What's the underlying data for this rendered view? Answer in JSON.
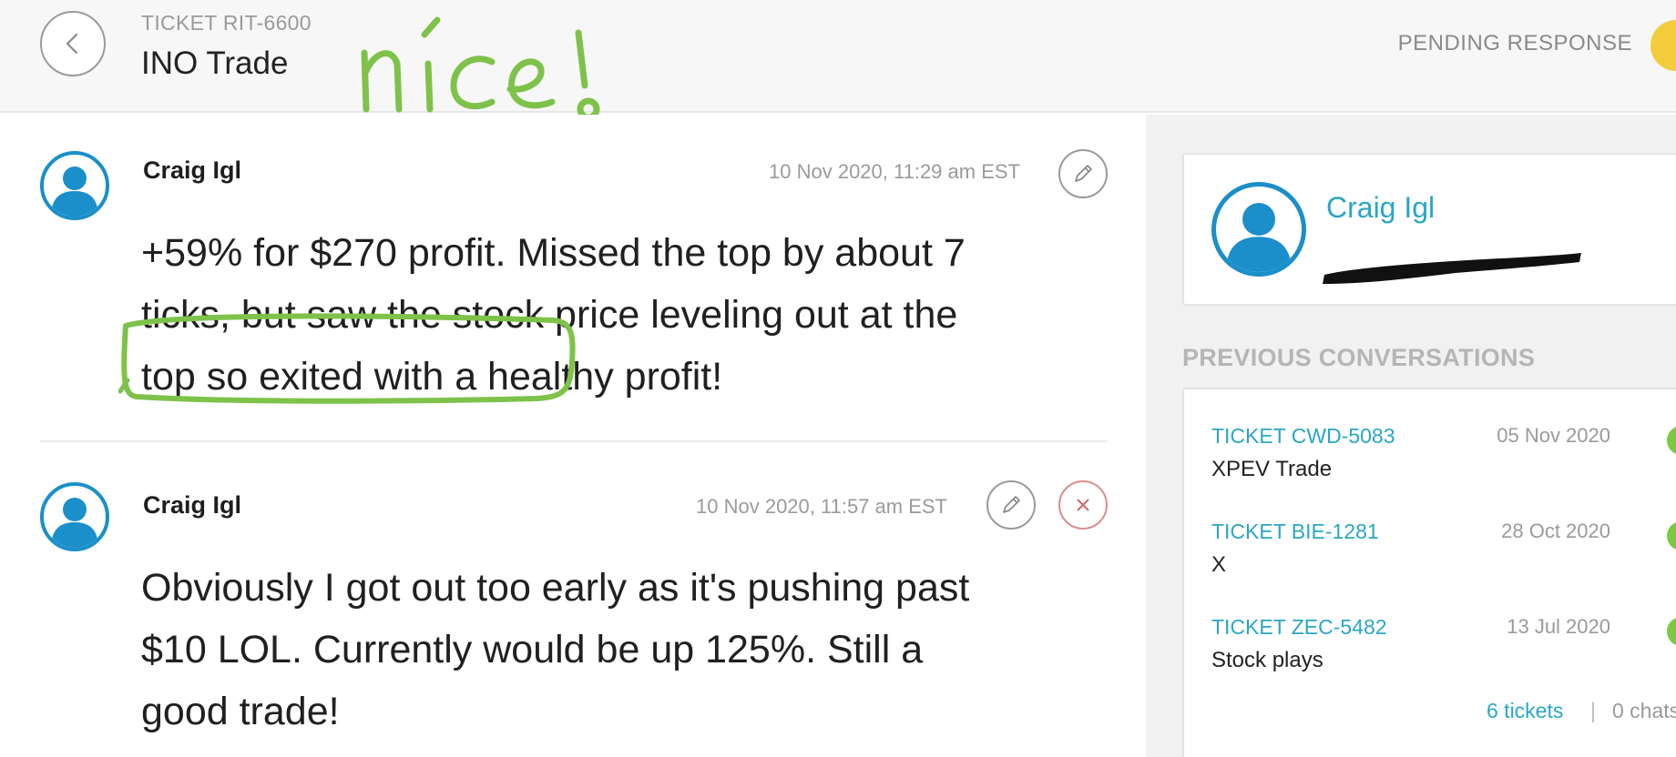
{
  "header": {
    "ticket_label": "TICKET RIT-6600",
    "title": "INO Trade",
    "status": "PENDING RESPONSE",
    "status_color": "#f3cc3b",
    "back_icon": "chevron-left-icon"
  },
  "annotations": {
    "handwritten_note": "nice!",
    "ink_color": "#7ec24a"
  },
  "messages": [
    {
      "author": "Craig Igl",
      "timestamp": "10 Nov 2020, 11:29 am EST",
      "body_lines": [
        "+59% for $270 profit. Missed the top by about 7",
        "ticks, but saw the stock price leveling out at the",
        "top so exited with a healthy profit!"
      ],
      "actions": [
        "edit-icon"
      ]
    },
    {
      "author": "Craig Igl",
      "timestamp": "10 Nov 2020, 11:57 am EST",
      "body_lines": [
        "Obviously I got out too early as it's pushing past",
        "$10 LOL. Currently would be up 125%. Still a",
        "good trade!"
      ],
      "actions": [
        "edit-icon",
        "close-icon"
      ]
    }
  ],
  "sidebar": {
    "profile_name": "Craig Igl",
    "previous_heading": "PREVIOUS CONVERSATIONS",
    "conversations": [
      {
        "ticket": "TICKET CWD-5083",
        "date": "05 Nov 2020",
        "subject": "XPEV Trade",
        "status_color": "#7bc843"
      },
      {
        "ticket": "TICKET BIE-1281",
        "date": "28 Oct 2020",
        "subject": "X",
        "status_color": "#7bc843"
      },
      {
        "ticket": "TICKET ZEC-5482",
        "date": "13 Jul 2020",
        "subject": "Stock plays",
        "status_color": "#7bc843"
      }
    ],
    "tickets_link": "6 tickets",
    "separator": "|",
    "chats_link": "0 chats"
  },
  "colors": {
    "accent": "#2aa6c5",
    "avatar_ring": "#1a8fca"
  }
}
